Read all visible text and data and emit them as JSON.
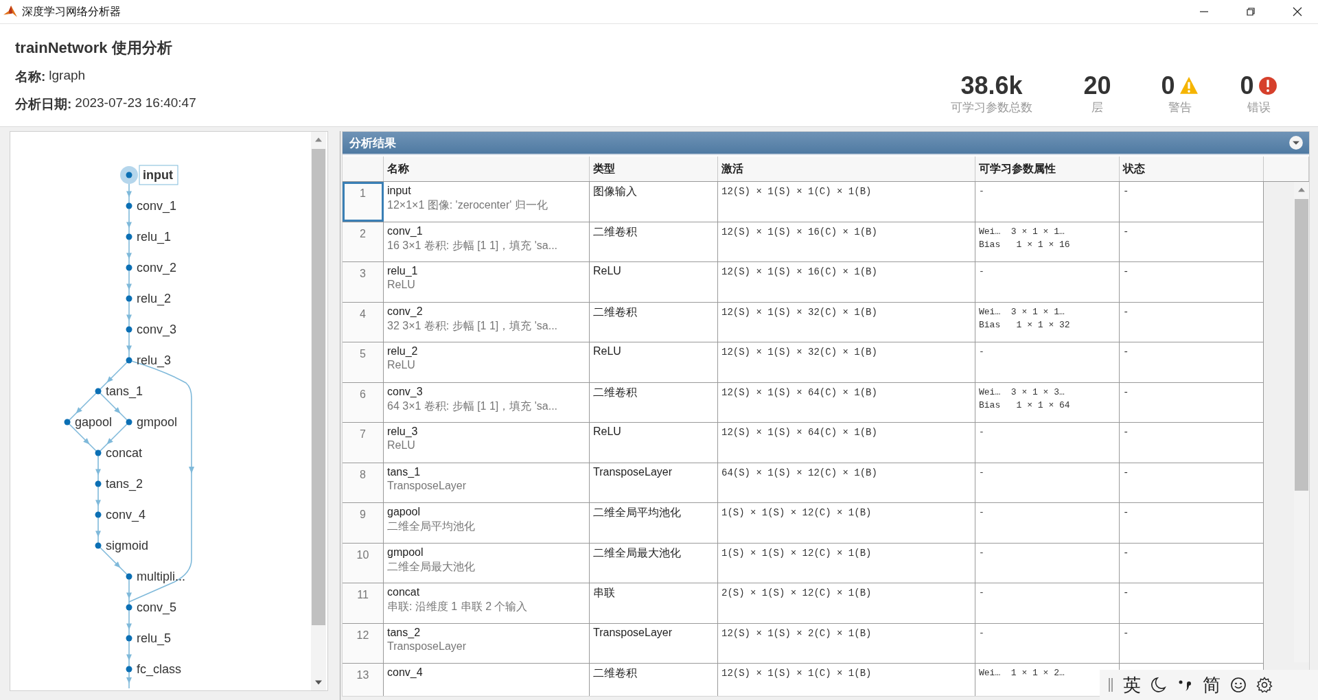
{
  "window": {
    "title": "深度学习网络分析器"
  },
  "header": {
    "title": "trainNetwork 使用分析",
    "name_label": "名称:",
    "name": "lgraph",
    "date_label": "分析日期:",
    "date": "2023-07-23 16:40:47"
  },
  "stats": [
    {
      "kind": "plain",
      "value": "38.6k",
      "label": "可学习参数总数"
    },
    {
      "kind": "plain",
      "value": "20",
      "label": "层"
    },
    {
      "kind": "warning",
      "value": "0",
      "label": "警告"
    },
    {
      "kind": "error",
      "value": "0",
      "label": "错误"
    }
  ],
  "graph": {
    "nodes": [
      {
        "label": "input",
        "selected": true
      },
      {
        "label": "conv_1",
        "selected": false
      },
      {
        "label": "relu_1",
        "selected": false
      },
      {
        "label": "conv_2",
        "selected": false
      },
      {
        "label": "relu_2",
        "selected": false
      },
      {
        "label": "conv_3",
        "selected": false
      },
      {
        "label": "relu_3",
        "selected": false
      },
      {
        "label": "tans_1",
        "selected": false
      },
      {
        "label": "gapool",
        "selected": false
      },
      {
        "label": "gmpool",
        "selected": false
      },
      {
        "label": "concat",
        "selected": false
      },
      {
        "label": "tans_2",
        "selected": false
      },
      {
        "label": "conv_4",
        "selected": false
      },
      {
        "label": "sigmoid",
        "selected": false
      },
      {
        "label": "multipli...",
        "selected": false
      },
      {
        "label": "conv_5",
        "selected": false
      },
      {
        "label": "relu_5",
        "selected": false
      },
      {
        "label": "fc_class",
        "selected": false
      }
    ]
  },
  "results": {
    "title": "分析结果",
    "columns": [
      "名称",
      "类型",
      "激活",
      "可学习参数属性",
      "状态"
    ],
    "rows": [
      {
        "index": "1",
        "name": "input",
        "description": "12×1×1 图像: 'zerocenter' 归一化",
        "type": "图像输入",
        "activation": "12(S) × 1(S) × 1(C) × 1(B)",
        "learnables": [
          "-"
        ],
        "state": "-",
        "selected": true
      },
      {
        "index": "2",
        "name": "conv_1",
        "description": "16 3×1 卷积: 步幅 [1 1]，填充 'sa...",
        "type": "二维卷积",
        "activation": "12(S) × 1(S) × 16(C) × 1(B)",
        "learnables": [
          "Wei…  3 × 1 × 1…",
          "Bias   1 × 1 × 16"
        ],
        "state": "-",
        "selected": false
      },
      {
        "index": "3",
        "name": "relu_1",
        "description": "ReLU",
        "type": "ReLU",
        "activation": "12(S) × 1(S) × 16(C) × 1(B)",
        "learnables": [
          "-"
        ],
        "state": "-",
        "selected": false
      },
      {
        "index": "4",
        "name": "conv_2",
        "description": "32 3×1 卷积: 步幅 [1 1]，填充 'sa...",
        "type": "二维卷积",
        "activation": "12(S) × 1(S) × 32(C) × 1(B)",
        "learnables": [
          "Wei…  3 × 1 × 1…",
          "Bias   1 × 1 × 32"
        ],
        "state": "-",
        "selected": false
      },
      {
        "index": "5",
        "name": "relu_2",
        "description": "ReLU",
        "type": "ReLU",
        "activation": "12(S) × 1(S) × 32(C) × 1(B)",
        "learnables": [
          "-"
        ],
        "state": "-",
        "selected": false
      },
      {
        "index": "6",
        "name": "conv_3",
        "description": "64 3×1 卷积: 步幅 [1 1]，填充 'sa...",
        "type": "二维卷积",
        "activation": "12(S) × 1(S) × 64(C) × 1(B)",
        "learnables": [
          "Wei…  3 × 1 × 3…",
          "Bias   1 × 1 × 64"
        ],
        "state": "-",
        "selected": false
      },
      {
        "index": "7",
        "name": "relu_3",
        "description": "ReLU",
        "type": "ReLU",
        "activation": "12(S) × 1(S) × 64(C) × 1(B)",
        "learnables": [
          "-"
        ],
        "state": "-",
        "selected": false
      },
      {
        "index": "8",
        "name": "tans_1",
        "description": "TransposeLayer",
        "type": "TransposeLayer",
        "activation": "64(S) × 1(S) × 12(C) × 1(B)",
        "learnables": [
          "-"
        ],
        "state": "-",
        "selected": false
      },
      {
        "index": "9",
        "name": "gapool",
        "description": "二维全局平均池化",
        "type": "二维全局平均池化",
        "activation": "1(S) × 1(S) × 12(C) × 1(B)",
        "learnables": [
          "-"
        ],
        "state": "-",
        "selected": false
      },
      {
        "index": "10",
        "name": "gmpool",
        "description": "二维全局最大池化",
        "type": "二维全局最大池化",
        "activation": "1(S) × 1(S) × 12(C) × 1(B)",
        "learnables": [
          "-"
        ],
        "state": "-",
        "selected": false
      },
      {
        "index": "11",
        "name": "concat",
        "description": "串联: 沿维度 1 串联 2 个输入",
        "type": "串联",
        "activation": "2(S) × 1(S) × 12(C) × 1(B)",
        "learnables": [
          "-"
        ],
        "state": "-",
        "selected": false
      },
      {
        "index": "12",
        "name": "tans_2",
        "description": "TransposeLayer",
        "type": "TransposeLayer",
        "activation": "12(S) × 1(S) × 2(C) × 1(B)",
        "learnables": [
          "-"
        ],
        "state": "-",
        "selected": false
      },
      {
        "index": "13",
        "name": "conv_4",
        "type": "二维卷积",
        "activation": "12(S) × 1(S) × 1(C) × 1(B)",
        "learnables": [
          "Wei…  1 × 1 × 2…"
        ],
        "selected": false
      }
    ]
  },
  "ime_toolbar": {
    "language": "英",
    "script": "简"
  }
}
